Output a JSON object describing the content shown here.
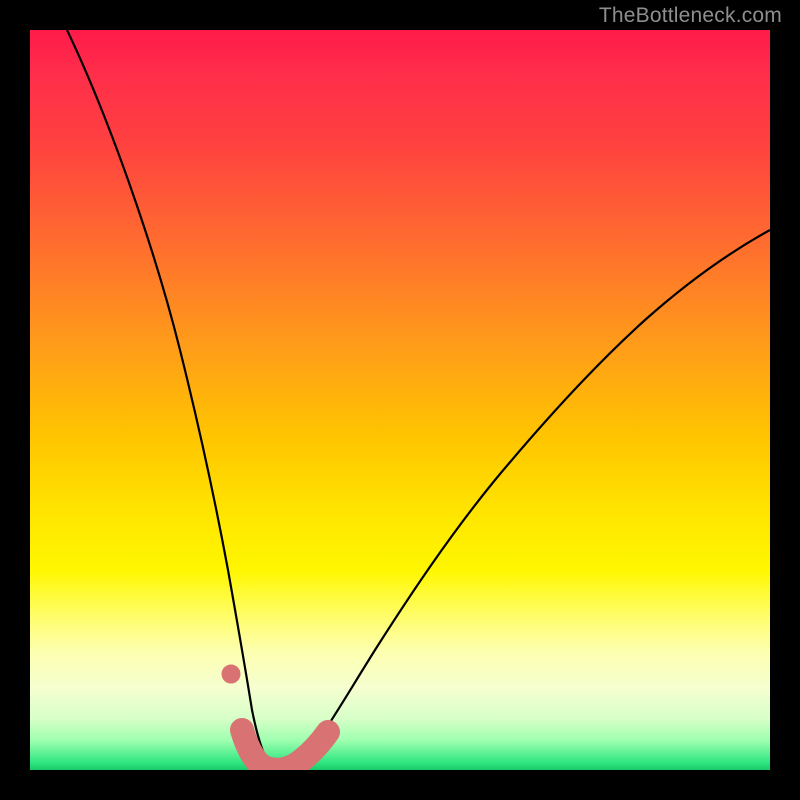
{
  "watermark": {
    "text": "TheBottleneck.com"
  },
  "colors": {
    "curve_stroke": "#000000",
    "marker_fill": "#d97373",
    "gradient_top": "#ff1a4a",
    "gradient_bottom": "#18c968",
    "frame": "#000000"
  },
  "chart_data": {
    "type": "line",
    "title": "",
    "xlabel": "",
    "ylabel": "",
    "xlim": [
      0,
      100
    ],
    "ylim": [
      0,
      100
    ],
    "grid": false,
    "legend": false,
    "note": "Stylized bottleneck curve. X axis is normalized component balance index (0–100). Y axis is bottleneck percentage (0–100). Values estimated from pixel positions; no axis ticks or numeric labels are rendered in the image.",
    "series": [
      {
        "name": "bottleneck-curve",
        "x": [
          5,
          10,
          15,
          18,
          20,
          22,
          24,
          26,
          27,
          28,
          29,
          30,
          32,
          34,
          36,
          40,
          45,
          52,
          60,
          70,
          82,
          95,
          100
        ],
        "values": [
          100,
          84,
          68,
          57,
          49,
          41,
          33,
          23,
          16,
          10,
          4,
          1,
          0,
          0,
          1,
          4,
          10,
          20,
          31,
          44,
          57,
          68,
          72
        ]
      }
    ],
    "markers": {
      "name": "highlighted-range",
      "color": "#d97373",
      "description": "Thick salmon dots/segment marking the near-zero-bottleneck region",
      "points": [
        {
          "x": 27.2,
          "y": 13.0,
          "r": 1.3
        },
        {
          "x": 28.6,
          "y": 5.5,
          "r": 2.0
        },
        {
          "x": 30.0,
          "y": 1.3,
          "r": 2.3
        },
        {
          "x": 31.5,
          "y": 0.3,
          "r": 2.3
        },
        {
          "x": 33.0,
          "y": 0.0,
          "r": 2.3
        },
        {
          "x": 34.5,
          "y": 0.3,
          "r": 2.3
        },
        {
          "x": 36.0,
          "y": 1.3,
          "r": 2.3
        },
        {
          "x": 37.8,
          "y": 3.0,
          "r": 2.3
        },
        {
          "x": 39.3,
          "y": 4.5,
          "r": 2.0
        }
      ]
    }
  }
}
